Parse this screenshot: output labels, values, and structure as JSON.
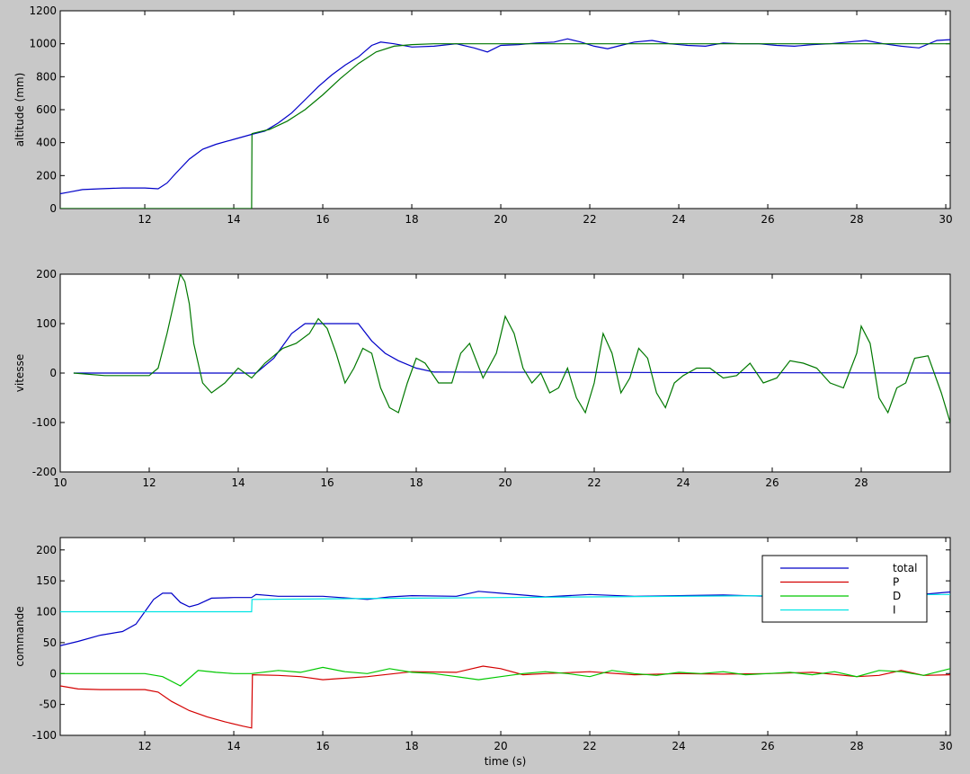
{
  "figure": {
    "background": "#c8c8c8"
  },
  "colors": {
    "blue": "#0000c8",
    "green": "#007800",
    "red": "#d40000",
    "lgreen": "#00c800",
    "cyan": "#00e4e4"
  },
  "chart_data": [
    {
      "type": "line",
      "ylabel": "altitude (mm)",
      "xlabel": "",
      "xlim": [
        10.1,
        30.1
      ],
      "ylim": [
        0,
        1200
      ],
      "xticks": [
        12,
        14,
        16,
        18,
        20,
        22,
        24,
        26,
        28,
        30
      ],
      "yticks": [
        0,
        200,
        400,
        600,
        800,
        1000,
        1200
      ],
      "ytick_labels": [
        "0",
        "200",
        "400",
        "600",
        "800",
        "1000",
        "1200"
      ],
      "series": [
        {
          "color": "blue",
          "x": [
            10.1,
            10.3,
            10.6,
            11.0,
            11.5,
            12.0,
            12.3,
            12.5,
            12.7,
            13.0,
            13.3,
            13.6,
            14.0,
            14.4,
            14.7,
            15.0,
            15.3,
            15.6,
            15.9,
            16.2,
            16.5,
            16.8,
            17.1,
            17.3,
            17.6,
            18.0,
            18.5,
            19.0,
            19.4,
            19.7,
            20.0,
            20.4,
            20.8,
            21.2,
            21.5,
            21.8,
            22.1,
            22.4,
            22.7,
            23.0,
            23.4,
            23.8,
            24.2,
            24.6,
            25.0,
            25.4,
            25.8,
            26.2,
            26.6,
            27.0,
            27.4,
            27.8,
            28.2,
            28.6,
            29.0,
            29.4,
            29.8,
            30.1
          ],
          "y": [
            90,
            100,
            115,
            120,
            125,
            125,
            120,
            155,
            215,
            300,
            360,
            390,
            420,
            450,
            470,
            520,
            580,
            660,
            740,
            810,
            870,
            920,
            990,
            1010,
            1000,
            980,
            985,
            1000,
            975,
            950,
            990,
            995,
            1005,
            1010,
            1030,
            1010,
            985,
            970,
            990,
            1010,
            1020,
            1000,
            990,
            985,
            1005,
            1000,
            1000,
            990,
            985,
            995,
            1000,
            1010,
            1020,
            1000,
            985,
            975,
            1020,
            1025
          ]
        },
        {
          "color": "green",
          "x": [
            10.1,
            14.4,
            14.41,
            14.8,
            15.2,
            15.6,
            16.0,
            16.4,
            16.8,
            17.2,
            17.6,
            18.0,
            18.5,
            19.0,
            25.0,
            30.1
          ],
          "y": [
            0,
            0,
            455,
            480,
            530,
            600,
            690,
            790,
            880,
            950,
            985,
            995,
            1000,
            1000,
            1000,
            1000
          ]
        }
      ]
    },
    {
      "type": "line",
      "ylabel": "vitesse",
      "xlabel": "",
      "xlim": [
        10,
        30
      ],
      "ylim": [
        -200,
        200
      ],
      "xticks": [
        10,
        12,
        14,
        16,
        18,
        20,
        22,
        24,
        26,
        28
      ],
      "yticks": [
        -200,
        -100,
        0,
        100,
        200
      ],
      "ytick_labels": [
        "-200",
        "-100",
        "0",
        "100",
        "200"
      ],
      "series": [
        {
          "color": "blue",
          "x": [
            10.3,
            14.4,
            14.8,
            15.2,
            15.5,
            16.7,
            17.0,
            17.3,
            17.6,
            18.0,
            18.4,
            30.0
          ],
          "y": [
            0,
            0,
            30,
            80,
            100,
            100,
            65,
            40,
            25,
            10,
            2,
            0
          ]
        },
        {
          "color": "green",
          "x": [
            10.3,
            11.0,
            11.5,
            12.0,
            12.2,
            12.4,
            12.6,
            12.7,
            12.8,
            12.9,
            13.0,
            13.2,
            13.4,
            13.7,
            14.0,
            14.3,
            14.6,
            15.0,
            15.3,
            15.6,
            15.8,
            16.0,
            16.2,
            16.4,
            16.6,
            16.8,
            17.0,
            17.2,
            17.4,
            17.6,
            17.8,
            18.0,
            18.2,
            18.5,
            18.8,
            19.0,
            19.2,
            19.5,
            19.8,
            20.0,
            20.2,
            20.4,
            20.6,
            20.8,
            21.0,
            21.2,
            21.4,
            21.6,
            21.8,
            22.0,
            22.2,
            22.4,
            22.6,
            22.8,
            23.0,
            23.2,
            23.4,
            23.6,
            23.8,
            24.0,
            24.3,
            24.6,
            24.9,
            25.2,
            25.5,
            25.8,
            26.1,
            26.4,
            26.7,
            27.0,
            27.3,
            27.6,
            27.9,
            28.0,
            28.2,
            28.4,
            28.6,
            28.8,
            29.0,
            29.2,
            29.5,
            29.8,
            30.0
          ],
          "y": [
            0,
            -5,
            -5,
            -5,
            10,
            80,
            160,
            200,
            185,
            140,
            60,
            -20,
            -40,
            -20,
            10,
            -10,
            20,
            50,
            60,
            80,
            110,
            90,
            40,
            -20,
            10,
            50,
            40,
            -30,
            -70,
            -80,
            -20,
            30,
            20,
            -20,
            -20,
            40,
            60,
            -10,
            40,
            115,
            80,
            10,
            -20,
            0,
            -40,
            -30,
            10,
            -50,
            -80,
            -20,
            80,
            40,
            -40,
            -10,
            50,
            30,
            -40,
            -70,
            -20,
            -5,
            10,
            10,
            -10,
            -5,
            20,
            -20,
            -10,
            25,
            20,
            10,
            -20,
            -30,
            40,
            95,
            60,
            -50,
            -80,
            -30,
            -20,
            30,
            35,
            -40,
            -100
          ]
        }
      ]
    },
    {
      "type": "line",
      "ylabel": "commande",
      "xlabel": "time (s)",
      "xlim": [
        10.1,
        30.1
      ],
      "ylim": [
        -100,
        220
      ],
      "xticks": [
        12,
        14,
        16,
        18,
        20,
        22,
        24,
        26,
        28,
        30
      ],
      "yticks": [
        -100,
        -50,
        0,
        50,
        100,
        150,
        200
      ],
      "ytick_labels": [
        "-100",
        "-50",
        "0",
        "50",
        "100",
        "150",
        "200"
      ],
      "legend": {
        "position": "top-right",
        "entries": [
          {
            "label": "total",
            "color": "blue"
          },
          {
            "label": "P",
            "color": "red"
          },
          {
            "label": "D",
            "color": "lgreen"
          },
          {
            "label": "I",
            "color": "cyan"
          }
        ]
      },
      "series": [
        {
          "name": "total",
          "color": "blue",
          "x": [
            10.1,
            10.5,
            11.0,
            11.5,
            11.8,
            12.0,
            12.2,
            12.4,
            12.6,
            12.8,
            13.0,
            13.2,
            13.5,
            14.0,
            14.4,
            14.5,
            15.0,
            16.0,
            17.0,
            17.5,
            18.0,
            19.0,
            19.5,
            20.0,
            21.0,
            22.0,
            23.0,
            24.0,
            25.0,
            26.0,
            27.0,
            28.0,
            29.0,
            30.1
          ],
          "y": [
            45,
            52,
            62,
            68,
            80,
            100,
            120,
            130,
            130,
            115,
            108,
            112,
            122,
            123,
            123,
            128,
            125,
            125,
            120,
            124,
            126,
            125,
            133,
            130,
            124,
            128,
            125,
            126,
            127,
            125,
            126,
            128,
            125,
            132
          ]
        },
        {
          "name": "P",
          "color": "red",
          "x": [
            10.1,
            10.5,
            11.0,
            11.5,
            12.0,
            12.3,
            12.6,
            13.0,
            13.4,
            13.8,
            14.2,
            14.4,
            14.42,
            15.0,
            15.5,
            16.0,
            17.0,
            18.0,
            19.0,
            19.6,
            20.0,
            20.5,
            21.0,
            22.0,
            23.0,
            24.0,
            25.0,
            26.0,
            27.0,
            28.0,
            28.5,
            29.0,
            29.5,
            30.1
          ],
          "y": [
            -20,
            -25,
            -26,
            -26,
            -26,
            -30,
            -45,
            -60,
            -70,
            -78,
            -85,
            -88,
            -2,
            -3,
            -5,
            -10,
            -5,
            3,
            2,
            12,
            8,
            -2,
            0,
            3,
            -2,
            0,
            -1,
            0,
            2,
            -5,
            -3,
            5,
            -3,
            -2
          ]
        },
        {
          "name": "D",
          "color": "lgreen",
          "x": [
            10.1,
            11.0,
            12.0,
            12.4,
            12.8,
            13.2,
            13.6,
            14.0,
            14.4,
            15.0,
            15.5,
            16.0,
            16.5,
            17.0,
            17.5,
            18.0,
            18.5,
            19.0,
            19.5,
            20.0,
            20.5,
            21.0,
            21.5,
            22.0,
            22.5,
            23.0,
            23.5,
            24.0,
            24.5,
            25.0,
            25.5,
            26.0,
            26.5,
            27.0,
            27.5,
            28.0,
            28.5,
            29.0,
            29.5,
            30.1
          ],
          "y": [
            0,
            0,
            0,
            -5,
            -20,
            5,
            2,
            0,
            0,
            5,
            2,
            10,
            3,
            0,
            8,
            2,
            0,
            -5,
            -10,
            -5,
            0,
            3,
            0,
            -5,
            5,
            0,
            -3,
            2,
            0,
            3,
            -2,
            0,
            2,
            -2,
            3,
            -5,
            5,
            3,
            -3,
            8
          ]
        },
        {
          "name": "I",
          "color": "cyan",
          "x": [
            10.1,
            14.4,
            14.41,
            18.0,
            22.0,
            26.0,
            30.1
          ],
          "y": [
            100,
            100,
            120,
            122,
            124,
            126,
            128
          ]
        }
      ]
    }
  ]
}
